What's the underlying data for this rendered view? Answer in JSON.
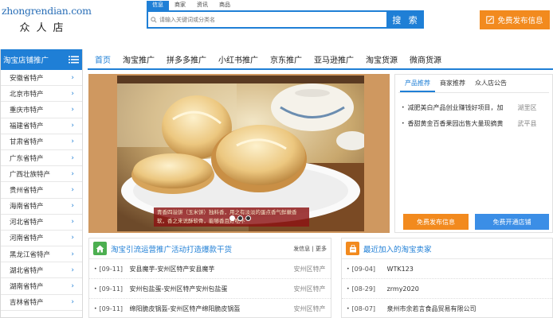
{
  "logo": {
    "domain": "zhongrendian.com",
    "name": "众人店"
  },
  "search": {
    "tabs": [
      "信息",
      "商家",
      "资讯",
      "商品"
    ],
    "placeholder": "请输入关键词或分类名",
    "button": "搜 索"
  },
  "publish_top": "免费发布信息",
  "sidebar": {
    "title": "淘宝店铺推广",
    "items": [
      "安徽省特产",
      "北京市特产",
      "重庆市特产",
      "福建省特产",
      "甘肃省特产",
      "广东省特产",
      "广西壮族特产",
      "贵州省特产",
      "海南省特产",
      "河北省特产",
      "河南省特产",
      "黑龙江省特产",
      "湖北省特产",
      "湖南省特产",
      "吉林省特产"
    ]
  },
  "nav": [
    "首页",
    "淘宝推广",
    "拼多多推广",
    "小红书推广",
    "京东推广",
    "亚马逊推广",
    "淘宝货源",
    "微商货源"
  ],
  "banner": {
    "caption": "青香四溢饼（玉米饼）独料香，用之有淡淡的蛋点香气鲜嫩香软，香之来说酥软骨，能够香且好吃不"
  },
  "panel": {
    "tabs": [
      "产品推荐",
      "商家推荐",
      "众人店公告"
    ],
    "items": [
      {
        "title": "减肥美白产品创业赚钱好项目，加",
        "loc": "湖里区"
      },
      {
        "title": "香甜黄金百香果园出售大量现摘黄",
        "loc": "武平县"
      }
    ],
    "btn_publish": "免费发布信息",
    "btn_shop": "免费开通店铺"
  },
  "section_left": {
    "title": "淘宝引流运营推广活动打造爆款干货",
    "more": "发信息 | 更多",
    "rows": [
      {
        "date": "[09-11]",
        "title": "安县魔芋-安州区特产安县魔芋",
        "loc": "安州区特产"
      },
      {
        "date": "[09-11]",
        "title": "安州包盐蛋-安州区特产安州包盐蛋",
        "loc": "安州区特产"
      },
      {
        "date": "[09-11]",
        "title": "绵阳脆皮锅盔-安州区特产绵阳脆皮锅盔",
        "loc": "安州区特产"
      }
    ]
  },
  "section_right": {
    "title": "最近加入的淘宝卖家",
    "rows": [
      {
        "date": "[09-04]",
        "title": "WTK123",
        "loc": ""
      },
      {
        "date": "[08-29]",
        "title": "zrmy2020",
        "loc": ""
      },
      {
        "date": "[08-07]",
        "title": "泉州市余若言食品贸易有限公司",
        "loc": ""
      }
    ]
  },
  "colors": {
    "brand_blue": "#1f7fd6",
    "accent_orange": "#f28a1e",
    "green": "#4caf50"
  }
}
